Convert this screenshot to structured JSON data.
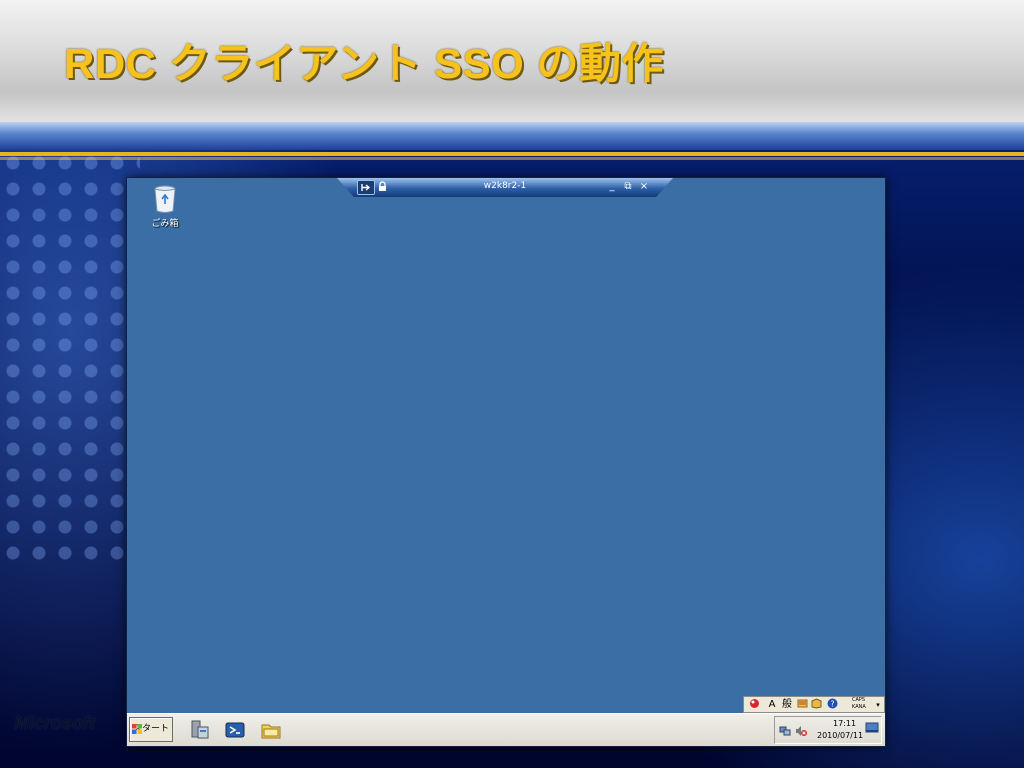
{
  "slide": {
    "title": "RDC クライアント SSO の動作",
    "brand": "Microsoft"
  },
  "connection_bar": {
    "host": "w2k8r2-1",
    "pin_icon": "pin-icon",
    "lock_icon": "lock-icon",
    "minimize_glyph": "_",
    "restore_glyph": "⧉",
    "close_glyph": "×"
  },
  "desktop": {
    "background_color": "#3a6ea5",
    "icons": [
      {
        "label": "ごみ箱",
        "icon": "recycle-bin-icon"
      }
    ]
  },
  "language_bar": {
    "input_mode": "A",
    "conversion_mode": "般",
    "caps": "CAPS",
    "kana": "KANA"
  },
  "taskbar": {
    "start_label": "スタート",
    "pinned": [
      {
        "icon": "server-manager-icon"
      },
      {
        "icon": "powershell-icon"
      },
      {
        "icon": "explorer-folder-icon"
      }
    ],
    "clock": {
      "time": "17:11",
      "date": "2010/07/11"
    }
  },
  "colors": {
    "title": "#f7c21b",
    "accent_line": "#e7b421",
    "taskbar": "#ece9d8"
  }
}
